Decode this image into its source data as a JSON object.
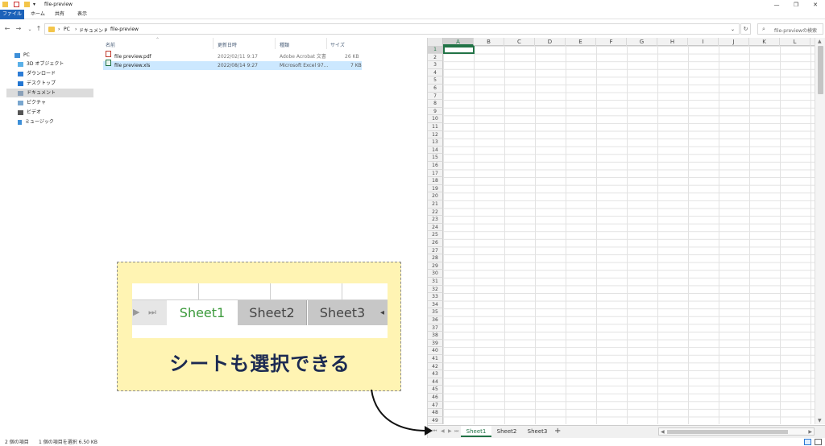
{
  "window": {
    "title": "file-preview",
    "controls": {
      "minimize": "—",
      "maximize": "❐",
      "close": "✕"
    }
  },
  "ribbon": {
    "tabs": [
      "ファイル",
      "ホーム",
      "共有",
      "表示"
    ]
  },
  "address": {
    "crumbs": [
      "PC",
      "ドキュメント",
      "file-preview"
    ],
    "search_placeholder": "file-previewの検索"
  },
  "nav": {
    "items": [
      {
        "label": "PC",
        "icon": "pc-icon"
      },
      {
        "label": "3D オブジェクト",
        "icon": "3d-objects-icon"
      },
      {
        "label": "ダウンロード",
        "icon": "download-icon"
      },
      {
        "label": "デスクトップ",
        "icon": "desktop-icon"
      },
      {
        "label": "ドキュメント",
        "icon": "documents-icon"
      },
      {
        "label": "ピクチャ",
        "icon": "pictures-icon"
      },
      {
        "label": "ビデオ",
        "icon": "video-icon"
      },
      {
        "label": "ミュージック",
        "icon": "music-icon"
      }
    ],
    "selected_index": 4
  },
  "list": {
    "headers": {
      "name": "名前",
      "date": "更新日時",
      "type": "種類",
      "size": "サイズ"
    },
    "files": [
      {
        "name": "file preview.pdf",
        "date": "2022/02/11 9:17",
        "type": "Adobe Acrobat 文書",
        "size": "26 KB",
        "icon": "pdf-file-icon"
      },
      {
        "name": "file preview.xls",
        "date": "2022/08/14 9:27",
        "type": "Microsoft Excel 97...",
        "size": "7 KB",
        "icon": "excel-file-icon"
      }
    ]
  },
  "status": {
    "count": "2 個の項目",
    "selection": "1 個の項目を選択  6.50 KB"
  },
  "sheet": {
    "columns": [
      "A",
      "B",
      "C",
      "D",
      "E",
      "F",
      "G",
      "H",
      "I",
      "J",
      "K",
      "L"
    ],
    "rows": [
      "1",
      "2",
      "3",
      "4",
      "5",
      "6",
      "7",
      "8",
      "9",
      "10",
      "11",
      "12",
      "13",
      "14",
      "15",
      "16",
      "17",
      "18",
      "19",
      "20",
      "21",
      "22",
      "23",
      "24",
      "25",
      "26",
      "27",
      "28",
      "29",
      "30",
      "31",
      "32",
      "33",
      "34",
      "35",
      "36",
      "37",
      "38",
      "39",
      "40",
      "41",
      "42",
      "43",
      "44",
      "45",
      "46",
      "47",
      "48",
      "49"
    ],
    "tabs": [
      "Sheet1",
      "Sheet2",
      "Sheet3"
    ],
    "active_tab": "Sheet1",
    "add_tab": "+",
    "accent": "#217346"
  },
  "callout": {
    "tabs": [
      "Sheet1",
      "Sheet2",
      "Sheet3"
    ],
    "caption": "シートも選択できる",
    "background": "#fff4b3"
  }
}
